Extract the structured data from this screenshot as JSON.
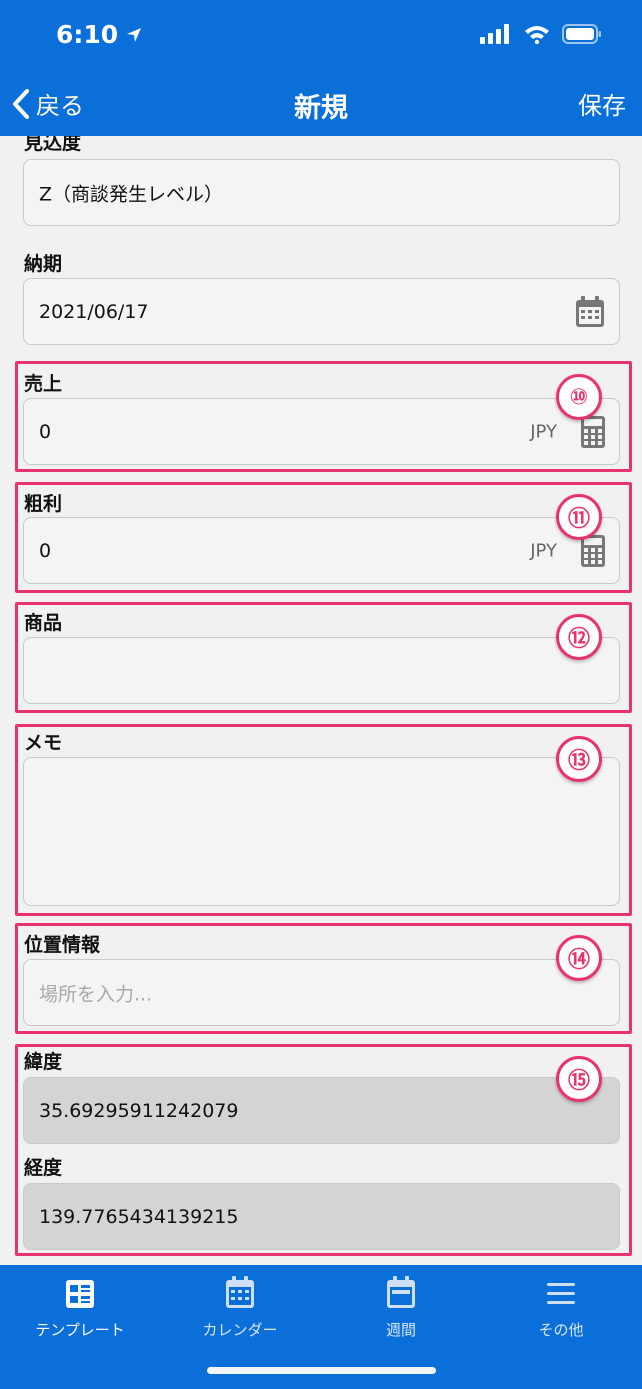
{
  "status": {
    "time": "6:10"
  },
  "nav": {
    "back_label": "戻る",
    "title": "新規",
    "save_label": "保存"
  },
  "fields": {
    "prospect": {
      "label": "見込度",
      "value": "Z（商談発生レベル）"
    },
    "due_date": {
      "label": "納期",
      "value": "2021/06/17"
    },
    "sales": {
      "label": "売上",
      "value": "0",
      "unit": "JPY"
    },
    "gross_profit": {
      "label": "粗利",
      "value": "0",
      "unit": "JPY"
    },
    "product": {
      "label": "商品",
      "value": ""
    },
    "memo": {
      "label": "メモ",
      "value": ""
    },
    "location": {
      "label": "位置情報",
      "placeholder": "場所を入力..."
    },
    "latitude": {
      "label": "緯度",
      "value": "35.69295911242079"
    },
    "longitude": {
      "label": "経度",
      "value": "139.7765434139215"
    }
  },
  "annotations": [
    "⑩",
    "⑪",
    "⑫",
    "⑬",
    "⑭",
    "⑮"
  ],
  "tabs": [
    {
      "label": "テンプレート",
      "icon": "template-icon"
    },
    {
      "label": "カレンダー",
      "icon": "calendar-icon"
    },
    {
      "label": "週間",
      "icon": "week-icon"
    },
    {
      "label": "その他",
      "icon": "menu-icon"
    }
  ],
  "colors": {
    "header": "#0b6fd9",
    "highlight": "#e8336d",
    "background": "#f2f1f2"
  }
}
